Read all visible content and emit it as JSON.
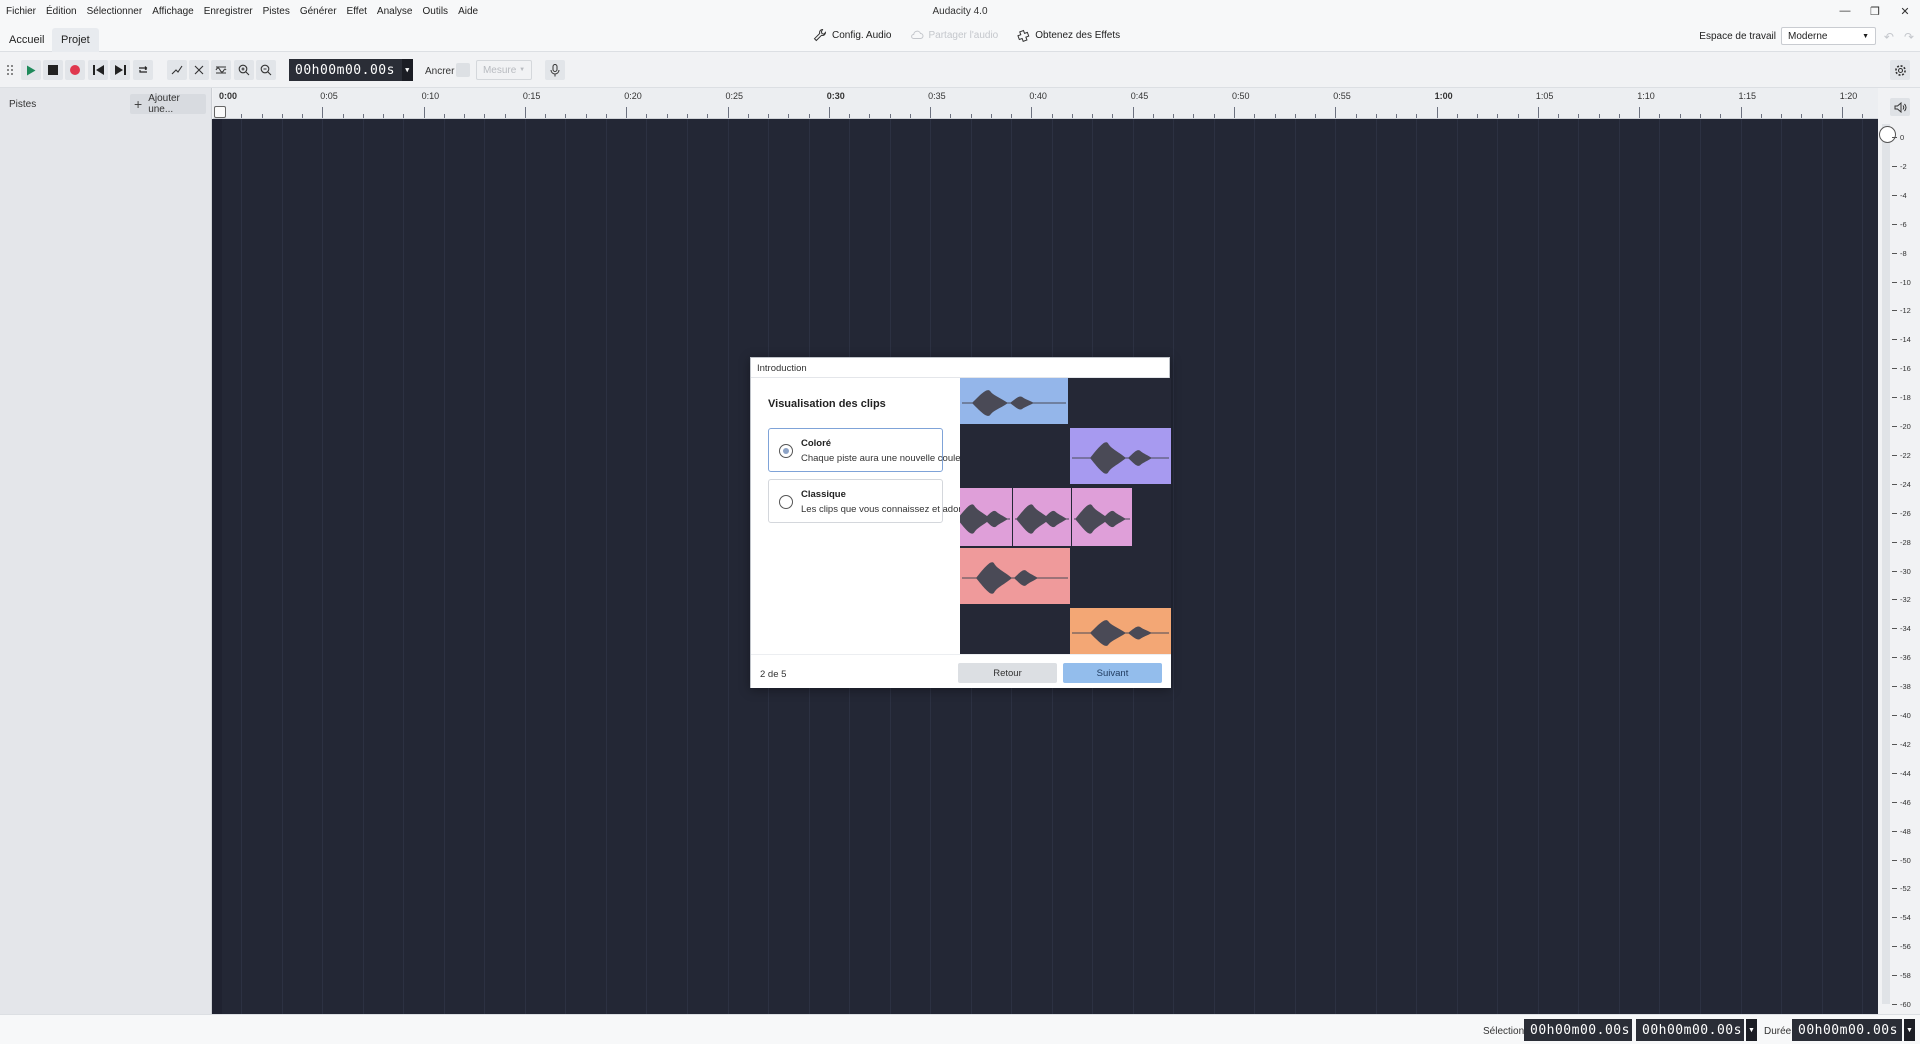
{
  "menu": [
    "Fichier",
    "Édition",
    "Sélectionner",
    "Affichage",
    "Enregistrer",
    "Pistes",
    "Générer",
    "Effet",
    "Analyse",
    "Outils",
    "Aide"
  ],
  "app_title": "Audacity 4.0",
  "tabs": {
    "home": "Accueil",
    "project": "Projet"
  },
  "center_tools": {
    "audio_config": "Config. Audio",
    "share_audio": "Partager l'audio",
    "get_effects": "Obtenez des Effets"
  },
  "workspace": {
    "label": "Espace de travail",
    "value": "Moderne"
  },
  "toolbar": {
    "timecode": "00h00m00.00s",
    "snap_label": "Ancrer",
    "measure": "Mesure"
  },
  "left_panel": {
    "title": "Pistes",
    "add_button": "Ajouter une..."
  },
  "ruler": [
    {
      "t": "0:00",
      "bold": true
    },
    {
      "t": "0:05",
      "bold": false
    },
    {
      "t": "0:10",
      "bold": false
    },
    {
      "t": "0:15",
      "bold": false
    },
    {
      "t": "0:20",
      "bold": false
    },
    {
      "t": "0:25",
      "bold": false
    },
    {
      "t": "0:30",
      "bold": true
    },
    {
      "t": "0:35",
      "bold": false
    },
    {
      "t": "0:40",
      "bold": false
    },
    {
      "t": "0:45",
      "bold": false
    },
    {
      "t": "0:50",
      "bold": false
    },
    {
      "t": "0:55",
      "bold": false
    },
    {
      "t": "1:00",
      "bold": true
    },
    {
      "t": "1:05",
      "bold": false
    },
    {
      "t": "1:10",
      "bold": false
    },
    {
      "t": "1:15",
      "bold": false
    },
    {
      "t": "1:20",
      "bold": false
    }
  ],
  "meter_scale": [
    "0",
    "-2",
    "-4",
    "-6",
    "-8",
    "-10",
    "-12",
    "-14",
    "-16",
    "-18",
    "-20",
    "-22",
    "-24",
    "-26",
    "-28",
    "-30",
    "-32",
    "-34",
    "-36",
    "-38",
    "-40",
    "-42",
    "-44",
    "-46",
    "-48",
    "-50",
    "-52",
    "-54",
    "-56",
    "-58",
    "-60"
  ],
  "dialog": {
    "title": "Introduction",
    "heading": "Visualisation des clips",
    "options": [
      {
        "title": "Coloré",
        "desc": "Chaque piste aura une nouvelle couleur",
        "selected": true
      },
      {
        "title": "Classique",
        "desc": "Les clips que vous connaissez et adorez",
        "selected": false
      }
    ],
    "page_indicator": "2 de 5",
    "back": "Retour",
    "next": "Suivant",
    "clip_colors": [
      "#94b6ea",
      "#a79af0",
      "#df9fd9",
      "#ef9a9b",
      "#f3a775"
    ]
  },
  "status": {
    "selection_label": "Sélection",
    "selection_start": "00h00m00.00s",
    "selection_end": "00h00m00.00s",
    "duration_label": "Durée",
    "duration": "00h00m00.00s"
  }
}
